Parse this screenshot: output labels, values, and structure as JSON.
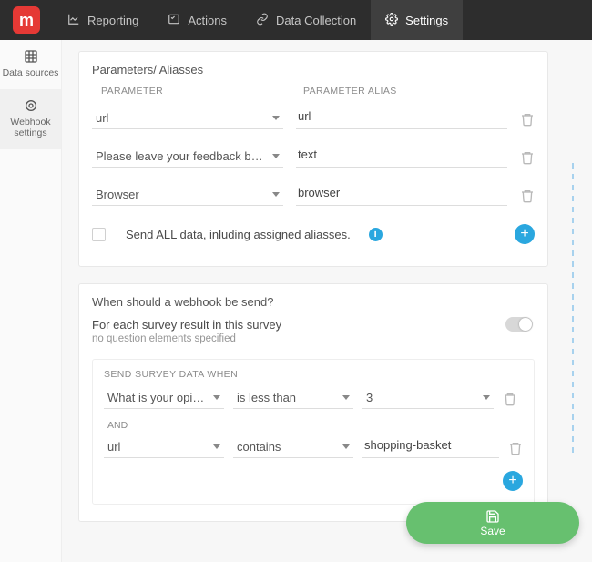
{
  "brand": {
    "letter": "m"
  },
  "topTabs": [
    {
      "label": "Reporting",
      "icon": "chart-line-icon",
      "active": false
    },
    {
      "label": "Actions",
      "icon": "checklist-icon",
      "active": false
    },
    {
      "label": "Data Collection",
      "icon": "link-icon",
      "active": false
    },
    {
      "label": "Settings",
      "icon": "gear-icon",
      "active": true
    }
  ],
  "sidebar": [
    {
      "label": "Data sources",
      "icon": "grid-icon",
      "active": false
    },
    {
      "label": "Webhook settings",
      "icon": "target-icon",
      "active": true
    }
  ],
  "paramsPanel": {
    "title": "Parameters/ Aliasses",
    "headers": {
      "left": "PARAMETER",
      "right": "PARAMETER ALIAS"
    },
    "rows": [
      {
        "param": "url",
        "alias": "url"
      },
      {
        "param": "Please leave your feedback below:",
        "alias": "text"
      },
      {
        "param": "Browser",
        "alias": "browser"
      }
    ],
    "sendAll": {
      "checked": false,
      "label": "Send ALL data, inluding assigned aliasses."
    }
  },
  "whenPanel": {
    "title": "When should a webhook be send?",
    "eachResult": {
      "label": "For each survey result in this survey",
      "sub": "no question elements specified",
      "enabled": false
    },
    "condTitle": "SEND SURVEY DATA WHEN",
    "andLabel": "AND",
    "conditions": [
      {
        "field": "What is your opinion of …",
        "op": "is less than",
        "value": "3",
        "valueIsSelect": true
      },
      {
        "field": "url",
        "op": "contains",
        "value": "shopping-basket",
        "valueIsSelect": false
      }
    ]
  },
  "saveLabel": "Save"
}
